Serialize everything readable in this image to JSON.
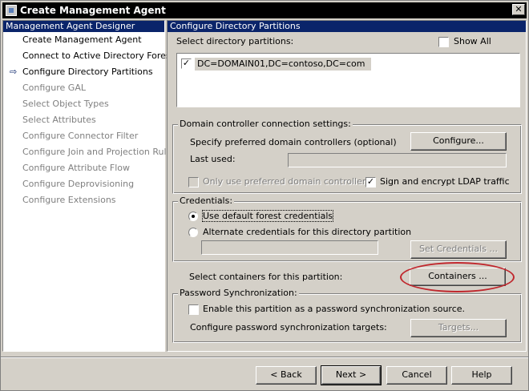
{
  "window": {
    "title": "Create Management Agent",
    "close_glyph": "✕"
  },
  "nav": {
    "header": "Management Agent Designer",
    "current_arrow": "⇨",
    "items": [
      {
        "label": "Create Management Agent",
        "state": "enabled"
      },
      {
        "label": "Connect to Active Directory Forest",
        "state": "enabled"
      },
      {
        "label": "Configure Directory Partitions",
        "state": "current"
      },
      {
        "label": "Configure GAL",
        "state": "disabled"
      },
      {
        "label": "Select Object Types",
        "state": "disabled"
      },
      {
        "label": "Select Attributes",
        "state": "disabled"
      },
      {
        "label": "Configure Connector Filter",
        "state": "disabled"
      },
      {
        "label": "Configure Join and Projection Rules",
        "state": "disabled"
      },
      {
        "label": "Configure Attribute Flow",
        "state": "disabled"
      },
      {
        "label": "Configure Deprovisioning",
        "state": "disabled"
      },
      {
        "label": "Configure Extensions",
        "state": "disabled"
      }
    ]
  },
  "main": {
    "header": "Configure Directory Partitions",
    "partitions_label": "Select directory partitions:",
    "show_all": {
      "label": "Show All",
      "checked": false
    },
    "partitions": [
      {
        "label": "DC=DOMAIN01,DC=contoso,DC=com",
        "checked": true
      }
    ],
    "dc_group": {
      "legend": "Domain controller connection settings:",
      "specify_label": "Specify preferred domain controllers (optional)",
      "configure_button": "Configure...",
      "last_used_label": "Last used:",
      "last_used_value": "",
      "only_preferred": {
        "label": "Only use preferred domain controllers",
        "checked": false,
        "enabled": false
      },
      "sign_encrypt": {
        "label": "Sign and encrypt LDAP traffic",
        "checked": true
      }
    },
    "credentials_group": {
      "legend": "Credentials:",
      "default_option": "Use default forest credentials",
      "alternate_option": "Alternate credentials for this directory partition",
      "selected": "default",
      "alternate_value": "",
      "set_credentials_button": "Set Credentials ..."
    },
    "containers": {
      "label": "Select containers for this partition:",
      "button": "Containers ..."
    },
    "password_group": {
      "legend": "Password Synchronization:",
      "enable": {
        "label": "Enable this partition as a password synchronization source.",
        "checked": false
      },
      "targets_label": "Configure password synchronization targets:",
      "targets_button": "Targets..."
    }
  },
  "footer": {
    "back": "< Back",
    "next": "Next >",
    "cancel": "Cancel",
    "help": "Help"
  },
  "colors": {
    "header_bg": "#0a246a",
    "dialog_bg": "#d4d0c8",
    "highlight_ellipse": "#c0272d"
  }
}
